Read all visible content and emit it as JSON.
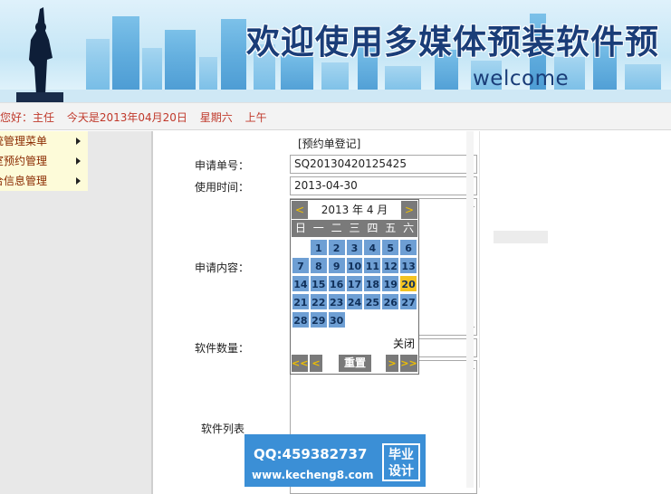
{
  "banner": {
    "title": "欢迎使用多媒体预装软件预",
    "subtitle": "welcome"
  },
  "status": {
    "greeting": "您好：主任",
    "date": "今天是2013年04月20日",
    "weekday": "星期六",
    "period": "上午"
  },
  "menu": {
    "items": [
      {
        "label": "统管理菜单"
      },
      {
        "label": "室预约管理"
      },
      {
        "label": "合信息管理"
      }
    ]
  },
  "form": {
    "section_title": "[预约单登记]",
    "request_no_label": "申请单号：",
    "request_no_value": "SQ20130420125425",
    "use_time_label": "使用时间：",
    "use_time_value": "2013-04-30",
    "content_label": "申请内容：",
    "quantity_label": "软件数量：",
    "list_label": "软件列表"
  },
  "calendar": {
    "prev": "<",
    "next": ">",
    "title": "2013 年 4 月",
    "weekdays": [
      "日",
      "一",
      "二",
      "三",
      "四",
      "五",
      "六"
    ],
    "weeks": [
      [
        "",
        "1",
        "2",
        "3",
        "4",
        "5",
        "6"
      ],
      [
        "7",
        "8",
        "9",
        "10",
        "11",
        "12",
        "13"
      ],
      [
        "14",
        "15",
        "16",
        "17",
        "18",
        "19",
        "20"
      ],
      [
        "21",
        "22",
        "23",
        "24",
        "25",
        "26",
        "27"
      ],
      [
        "28",
        "29",
        "30",
        "",
        "",
        "",
        ""
      ]
    ],
    "today": "20",
    "close": "关闭",
    "prev_year": "<<",
    "prev_month": "<",
    "reset": "重置",
    "next_month": ">",
    "next_year": ">>",
    "colors": {
      "day": "#6e9fd4",
      "today": "#f3c321",
      "nav": "#7a7a7a"
    }
  },
  "ad": {
    "qq": "QQ:459382737",
    "url": "www.kecheng8.com",
    "badge_line1": "毕业",
    "badge_line2": "设计"
  }
}
